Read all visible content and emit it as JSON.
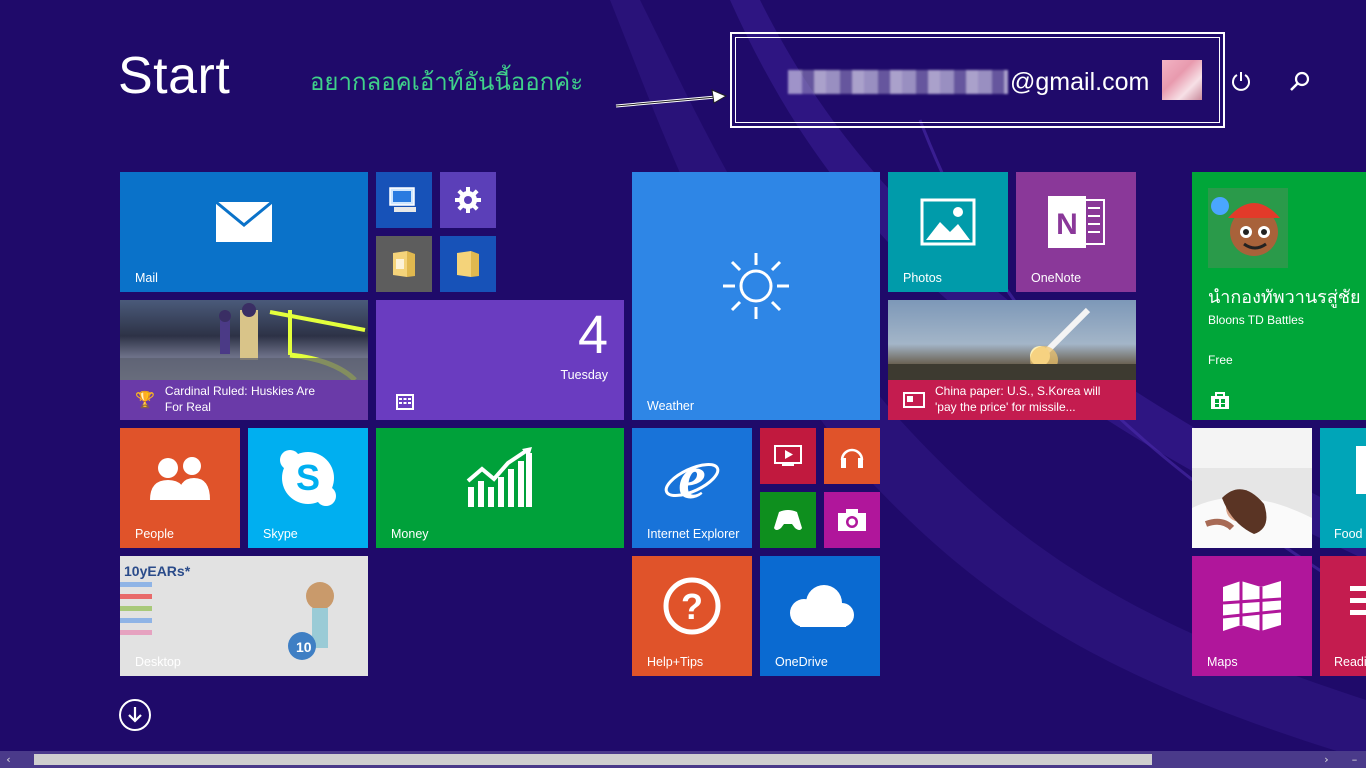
{
  "screen": {
    "title": "Start",
    "annotation": "อยากลอคเอ้าท์อันนี้ออกค่ะ",
    "user": {
      "email_suffix": "@gmail.com"
    }
  },
  "icons": {
    "power": "power-icon",
    "search": "search-icon",
    "down": "arrow-down-circle-icon"
  },
  "tiles": {
    "mail": {
      "label": "Mail",
      "color": "#0a72c9"
    },
    "this_pc": {
      "color": "#1752b8"
    },
    "settings": {
      "color": "#5b3fb8"
    },
    "folder1": {
      "color": "#5d5d5d"
    },
    "folder2": {
      "color": "#1752b8"
    },
    "sports": {
      "label": "Cardinal Ruled: Huskies Are For Real",
      "color": "#6a3aa8"
    },
    "calendar": {
      "day": "4",
      "weekday": "Tuesday",
      "color": "#6a3cc0"
    },
    "weather": {
      "label": "Weather",
      "color": "#2e86e6"
    },
    "photos": {
      "label": "Photos",
      "color": "#009baa"
    },
    "onenote": {
      "label": "OneNote",
      "color": "#8a3899"
    },
    "news": {
      "label": "China paper: U.S., S.Korea will 'pay the price' for missile...",
      "color": "#c41c4f"
    },
    "store_app": {
      "title": "นำกองทัพวานรสู่ชัย",
      "name": "Bloons TD Battles",
      "price": "Free",
      "color": "#00a639"
    },
    "people": {
      "label": "People",
      "color": "#e0532a"
    },
    "skype": {
      "label": "Skype",
      "color": "#00aff0"
    },
    "money": {
      "label": "Money",
      "color": "#00a13a"
    },
    "ie": {
      "label": "Internet Explorer",
      "color": "#1873d9"
    },
    "video": {
      "color": "#c1193e"
    },
    "music": {
      "color": "#e0532a"
    },
    "games": {
      "color": "#0e8f1e"
    },
    "camera": {
      "color": "#b0169b"
    },
    "food": {
      "label": "Food",
      "color": "#00a5b8"
    },
    "desktop": {
      "label": "Desktop"
    },
    "help": {
      "label": "Help+Tips",
      "color": "#e0532a"
    },
    "onedrive": {
      "label": "OneDrive",
      "color": "#0a6ad1"
    },
    "maps": {
      "label": "Maps",
      "color": "#b0169b"
    },
    "reading": {
      "label": "Readi",
      "color": "#c41c4f"
    }
  }
}
